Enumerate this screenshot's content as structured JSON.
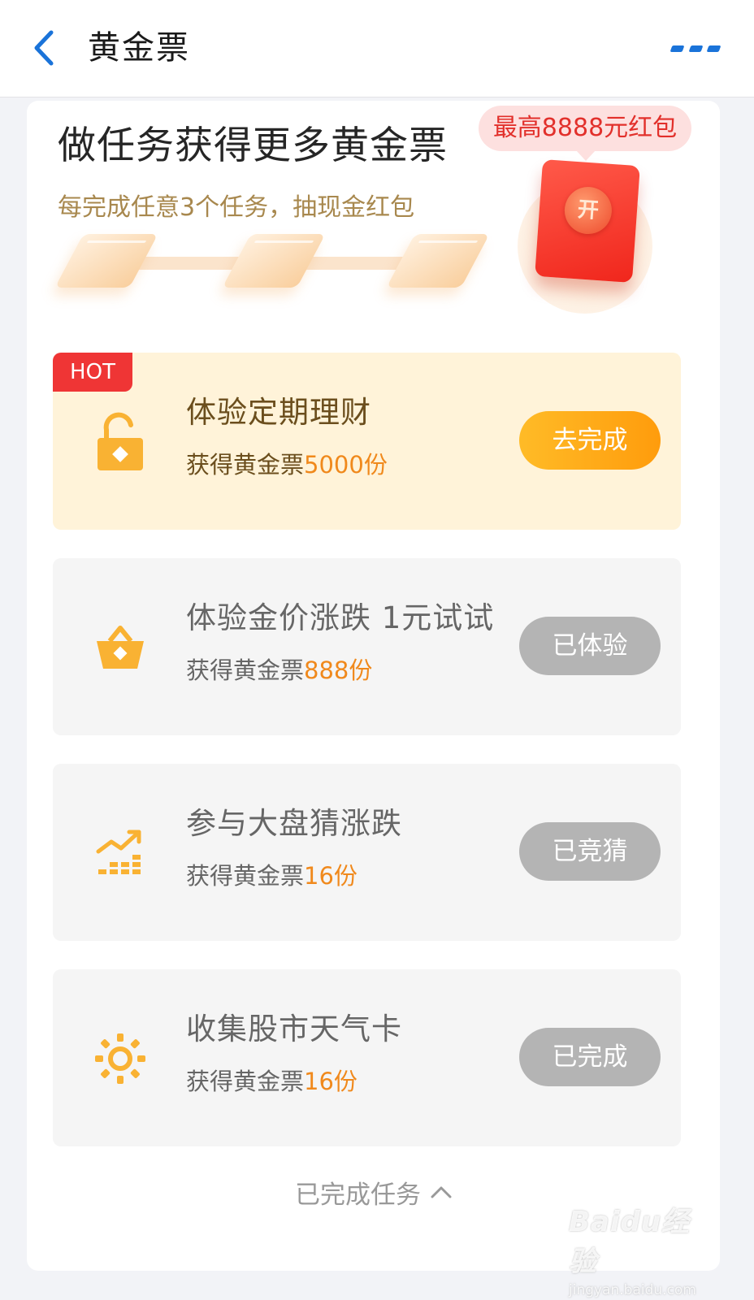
{
  "topbar": {
    "title": "黄金票",
    "icons": {
      "back": "chevron-left-icon",
      "more": "more-dots-icon"
    },
    "accent_color": "#1a73d9"
  },
  "header": {
    "title": "做任务获得更多黄金票",
    "subtitle": "每完成任意3个任务，抽现金红包",
    "max_badge": "最高8888元红包",
    "redpacket_open": "开"
  },
  "tasks": [
    {
      "badge": "HOT",
      "title": "体验定期理财",
      "reward_prefix": "获得黄金票",
      "reward_count": "5000份",
      "button": "去完成",
      "icon": "unlock-icon"
    },
    {
      "title": "体验金价涨跌 1元试试",
      "reward_prefix": "获得黄金票",
      "reward_count": "888份",
      "button": "已体验",
      "icon": "shopping-basket-icon"
    },
    {
      "title": "参与大盘猜涨跌",
      "reward_prefix": "获得黄金票",
      "reward_count": "16份",
      "button": "已竞猜",
      "icon": "trend-chart-icon"
    },
    {
      "title": "收集股市天气卡",
      "reward_prefix": "获得黄金票",
      "reward_count": "16份",
      "button": "已完成",
      "icon": "sun-icon"
    }
  ],
  "footer": {
    "completed_tasks": "已完成任务"
  },
  "watermark": {
    "brand": "Baidu经验",
    "url": "jingyan.baidu.com"
  },
  "colors": {
    "page_bg": "#f2f3f7",
    "hot_bg": "#fff3d9",
    "task_bg": "#f5f5f5",
    "orange": "#f0891c",
    "hot_badge": "#ef3535",
    "active_button": "#ffa41a",
    "disabled_button": "#b4b4b4",
    "icon_orange": "#f9b233"
  }
}
